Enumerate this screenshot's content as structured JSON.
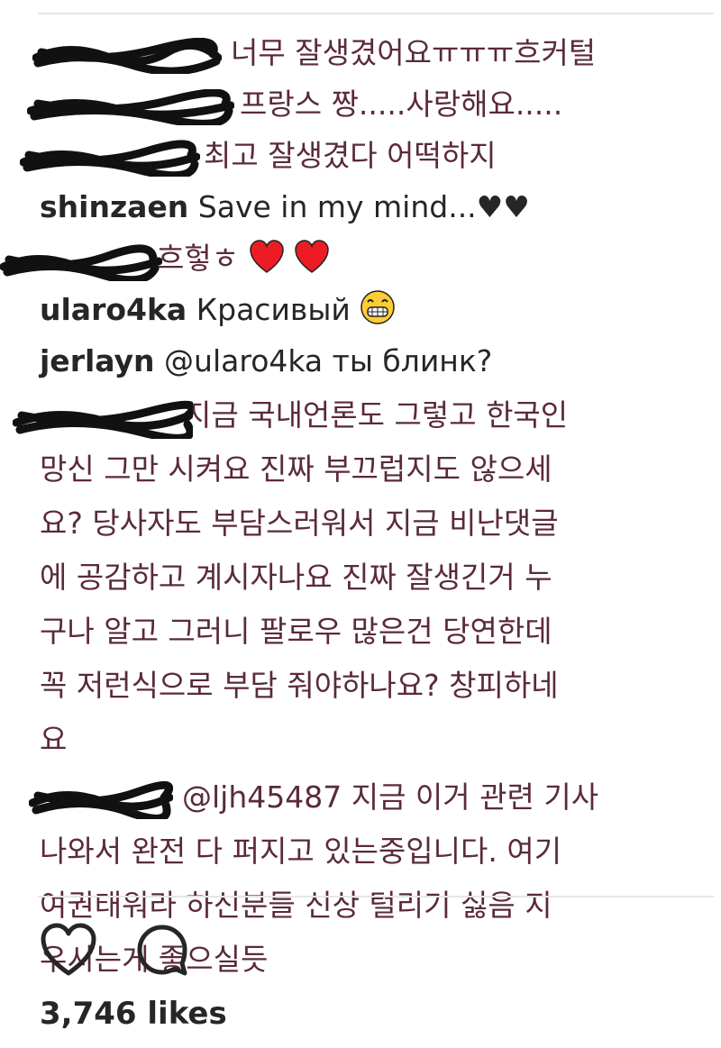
{
  "comments": [
    {
      "user": "",
      "text": "너무 잘생겼어요ㅠㅠㅠ흐커털"
    },
    {
      "user": "",
      "text": "프랑스 짱.....사랑해요....."
    },
    {
      "user": "",
      "text": "최고 잘생겼다 어떡하지"
    },
    {
      "user": "shinzaen",
      "text": "Save in my mind...♥♥"
    },
    {
      "user": "",
      "text": "흐헣ㅎ",
      "hearts": [
        "red-heart-emoji",
        "red-heart-emoji"
      ]
    },
    {
      "user": "ularo4ka",
      "text": "Красивый",
      "emoji": "grinning-face-emoji"
    },
    {
      "user": "jerlayn",
      "text": "@ularo4ka ты блинк?"
    },
    {
      "user": "",
      "lines": [
        "지금 국내언론도 그렇고 한국인",
        "망신 그만 시켜요 진짜 부끄럽지도 않으세",
        "요? 당사자도 부담스러워서 지금 비난댓글",
        "에 공감하고 계시자나요 진짜 잘생긴거 누",
        "구나 알고 그러니 팔로우 많은건 당연한데",
        "꼭 저런식으로 부담 줘야하나요? 창피하네",
        "요"
      ]
    },
    {
      "user": "",
      "lines": [
        "@ljh45487 지금 이거 관련 기사",
        "나와서 완전 다 퍼지고 있는중입니다. 여기",
        "여권태워라 하신분들 신상 털리기 싫음 지",
        "우시는게 좋으실듯"
      ]
    }
  ],
  "actions": {
    "like_icon": "heart-outline-icon",
    "comment_icon": "speech-bubble-icon"
  },
  "likes": "3,746 likes",
  "colors": {
    "text": "#262626",
    "korean_text": "#5a2a3c",
    "divider": "#e6e6e6",
    "redaction": "#111111",
    "heart": "#ed1c24"
  }
}
